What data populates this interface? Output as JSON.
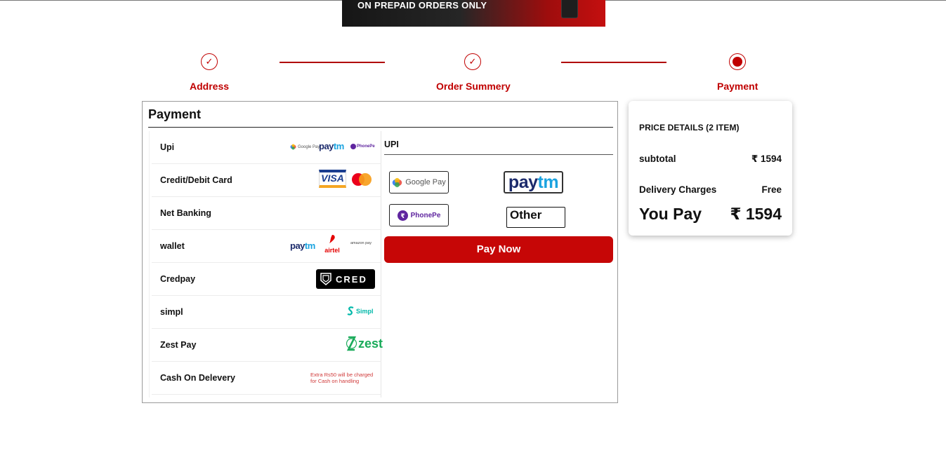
{
  "banner": {
    "text": "ON PREPAID ORDERS ONLY"
  },
  "stepper": {
    "steps": [
      {
        "label": "Address",
        "done_icon": "✓"
      },
      {
        "label": "Order Summery",
        "done_icon": "✓"
      },
      {
        "label": "Payment"
      }
    ]
  },
  "payment": {
    "title": "Payment",
    "methods": [
      {
        "label": "Upi"
      },
      {
        "label": "Credit/Debit Card"
      },
      {
        "label": "Net Banking"
      },
      {
        "label": "wallet"
      },
      {
        "label": "Credpay"
      },
      {
        "label": "simpl"
      },
      {
        "label": "Zest Pay"
      },
      {
        "label": "Cash On Delevery"
      }
    ],
    "cod_note": {
      "line1": "Extra Rs50 will be charged",
      "line2": "for Cash on handling"
    },
    "logo_text": {
      "google_pay_small": "Google Pay",
      "phonepe_small": "PhonePe",
      "paytm_pay": "pay",
      "paytm_tm": "tm",
      "visa": "VISA",
      "airtel": "airtel",
      "amazon_pay": "amazon pay",
      "cred": "CRED",
      "simpl": "Simpl",
      "zest": "zest"
    },
    "upi": {
      "title": "UPI",
      "google_pay": "Google Pay",
      "phonepe": "PhonePe",
      "other": "Other",
      "pay_now": "Pay Now"
    }
  },
  "price_details": {
    "title": "PRICE DETAILS (2 ITEM)",
    "subtotal_label": "subtotal",
    "subtotal_value": "₹ 1594",
    "delivery_label": "Delivery Charges",
    "delivery_value": "Free",
    "total_label": "You Pay",
    "total_value": "₹ 1594"
  },
  "colors": {
    "accent": "#c00000",
    "pay_button": "#c60606",
    "paytm_dark": "#1b2a6b",
    "paytm_light": "#1aa3e0",
    "phonepe": "#5f259f",
    "simpl": "#00b8a9",
    "zest": "#1aab5a"
  },
  "icons": [
    "check-icon",
    "radio-active-icon",
    "google-pay-icon",
    "phonepe-icon",
    "mastercard-icon",
    "airtel-icon",
    "cred-icon",
    "simpl-icon",
    "zest-icon"
  ]
}
